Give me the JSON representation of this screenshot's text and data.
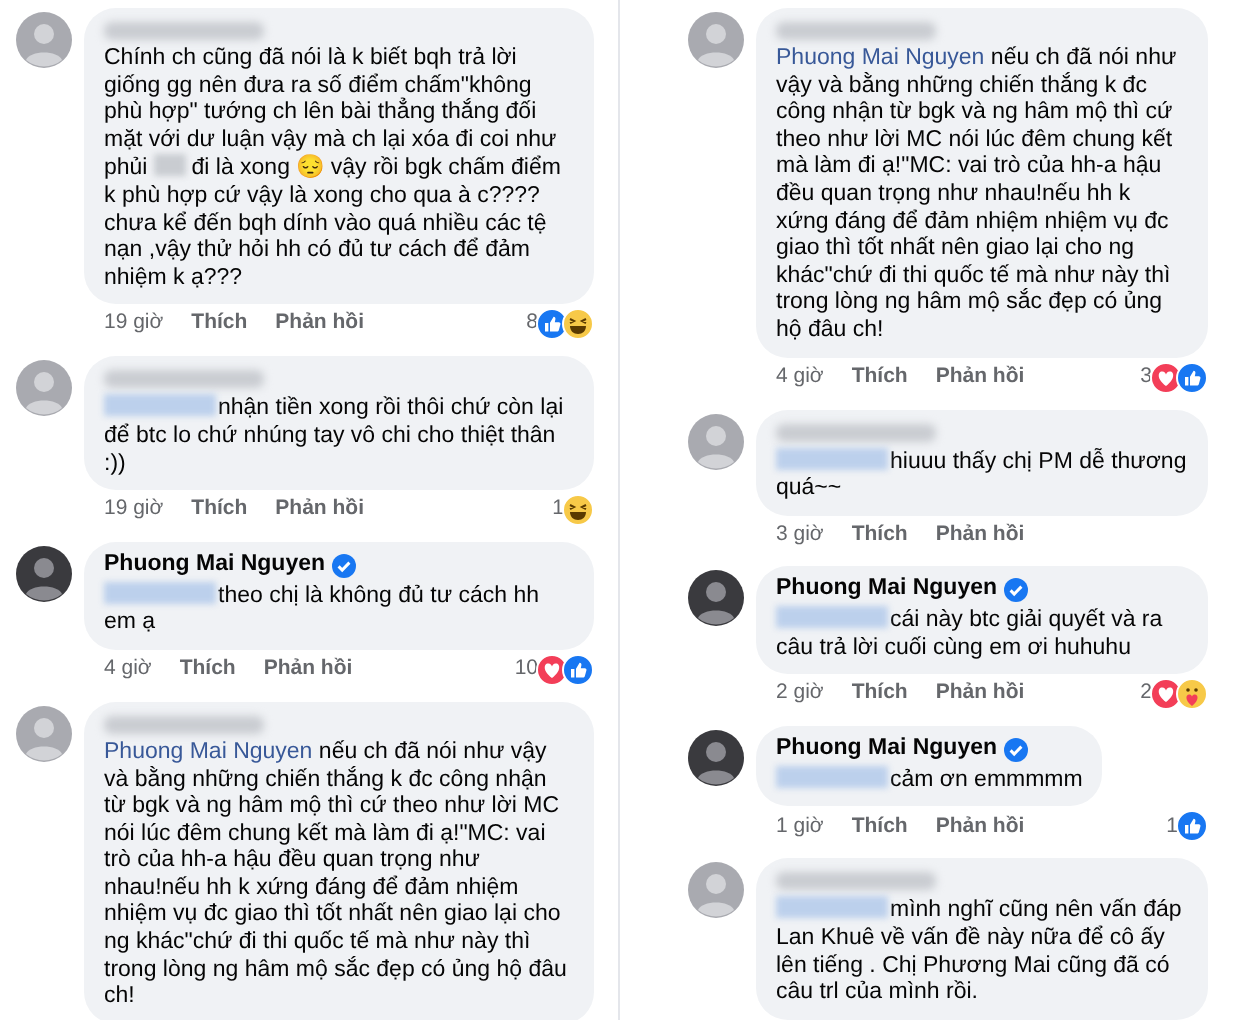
{
  "columns": [
    {
      "comments": [
        {
          "author_blurred": true,
          "segments": [
            {
              "kind": "text",
              "text": "Chính ch cũng đã nói là k biết bqh trả lời giống gg nên đưa ra số điểm chấm\"không phù hợp\" tướng ch lên bài thẳng thắng đối mặt với dư luận vậy mà ch lại xóa đi coi như phủi"
            },
            {
              "kind": "censored"
            },
            {
              "kind": "text",
              "text": "đi là xong 😔 vậy rồi bgk chấm điểm k phù hợp cứ vậy là xong cho qua à c????chưa kể đến bqh dính vào quá nhiều các tệ nạn ,vậy thử hỏi hh có đủ tư cách để đảm nhiệm k ạ???"
            }
          ],
          "footer": {
            "time": "19 giờ",
            "like": "Thích",
            "reply": "Phản hồi",
            "count": "8",
            "reactions": [
              {
                "kind": "like"
              },
              {
                "kind": "haha"
              }
            ]
          }
        },
        {
          "author_blurred": true,
          "segments": [
            {
              "kind": "blurred_mention"
            },
            {
              "kind": "text",
              "text": "nhận tiền xong rồi thôi chứ còn lại để btc lo chứ nhúng tay vô chi cho thiệt thân :))"
            }
          ],
          "footer": {
            "time": "19 giờ",
            "like": "Thích",
            "reply": "Phản hồi",
            "count": "1",
            "reactions": [
              {
                "kind": "haha"
              }
            ]
          }
        },
        {
          "author": "Phuong Mai Nguyen",
          "verified": true,
          "segments": [
            {
              "kind": "blurred_mention"
            },
            {
              "kind": "text",
              "text": "theo chị là không đủ tư cách hh em ạ"
            }
          ],
          "footer": {
            "time": "4 giờ",
            "like": "Thích",
            "reply": "Phản hồi",
            "count": "10",
            "reactions": [
              {
                "kind": "love"
              },
              {
                "kind": "like"
              }
            ]
          }
        },
        {
          "author_blurred": true,
          "segments": [
            {
              "kind": "mention",
              "text": "Phuong Mai Nguyen"
            },
            {
              "kind": "text",
              "text": "nếu ch đã nói như vậy và bằng những chiến thắng k đc công nhận từ bgk và ng hâm mộ thì cứ theo như lời MC nói lúc đêm chung kết mà làm đi ạ!\"MC: vai trò của hh-a hậu đều quan trọng như nhau!nếu hh k xứng đáng để đảm nhiệm nhiệm vụ đc giao thì tốt nhất nên giao lại cho ng khác\"chứ đi thi quốc tế mà như này thì trong lòng ng hâm mộ sắc đẹp có ủng hộ đâu ch!"
            }
          ]
        }
      ]
    },
    {
      "comments": [
        {
          "author_blurred": true,
          "segments": [
            {
              "kind": "mention",
              "text": "Phuong Mai Nguyen"
            },
            {
              "kind": "text",
              "text": "nếu ch đã nói như vậy và bằng những chiến thắng k đc công nhận từ bgk và ng hâm mộ thì cứ theo như lời MC nói lúc đêm chung kết mà làm đi ạ!\"MC: vai trò của hh-a hậu đều quan trọng như nhau!nếu hh k xứng đáng để đảm nhiệm nhiệm vụ đc giao thì tốt nhất nên giao lại cho ng khác\"chứ đi thi quốc tế mà như này thì trong lòng ng hâm mộ sắc đẹp có ủng hộ đâu ch!"
            }
          ],
          "footer": {
            "time": "4 giờ",
            "like": "Thích",
            "reply": "Phản hồi",
            "count": "3",
            "reactions": [
              {
                "kind": "love"
              },
              {
                "kind": "like"
              }
            ]
          }
        },
        {
          "author_blurred": true,
          "segments": [
            {
              "kind": "blurred_mention"
            },
            {
              "kind": "text",
              "text": "hiuuu thấy chị PM dễ thương quá~~"
            }
          ],
          "footer": {
            "time": "3 giờ",
            "like": "Thích",
            "reply": "Phản hồi"
          }
        },
        {
          "author": "Phuong Mai Nguyen",
          "verified": true,
          "segments": [
            {
              "kind": "blurred_mention"
            },
            {
              "kind": "text",
              "text": "cái này btc giải quyết và ra câu trả lời cuối cùng em ơi huhuhu"
            }
          ],
          "footer": {
            "time": "2 giờ",
            "like": "Thích",
            "reply": "Phản hồi",
            "count": "2",
            "reactions": [
              {
                "kind": "love"
              },
              {
                "kind": "care"
              }
            ]
          }
        },
        {
          "author": "Phuong Mai Nguyen",
          "verified": true,
          "segments": [
            {
              "kind": "blurred_mention"
            },
            {
              "kind": "text",
              "text": "cảm ơn emmmmm"
            }
          ],
          "footer": {
            "time": "1 giờ",
            "like": "Thích",
            "reply": "Phản hồi",
            "count": "1",
            "reactions": [
              {
                "kind": "like"
              }
            ]
          }
        },
        {
          "author_blurred": true,
          "segments": [
            {
              "kind": "blurred_mention"
            },
            {
              "kind": "text",
              "text": "mình nghĩ cũng nên vấn đáp Lan Khuê về vấn đề này nữa để cô ấy lên tiếng . Chị Phương Mai cũng đã có câu trl của mình rồi."
            }
          ]
        }
      ]
    }
  ]
}
